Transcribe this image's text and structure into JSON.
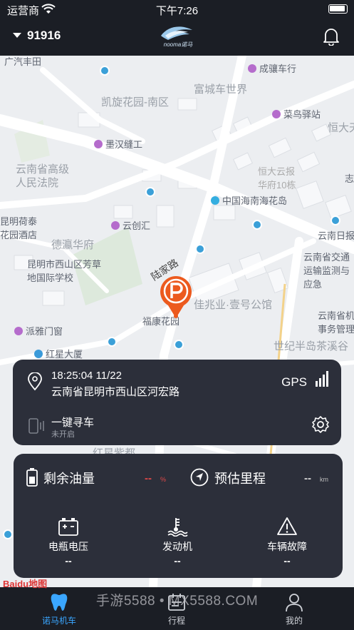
{
  "status_bar": {
    "carrier": "运营商",
    "time": "下午7:26"
  },
  "header": {
    "device_id": "91916",
    "logo_text": "nooma诺马"
  },
  "map": {
    "pois": [
      "广汽丰田",
      "凯旋花园-南区",
      "富城车世界",
      "成骧车行",
      "菜鸟驿站",
      "恒大天",
      "墨汉缝工",
      "云南省高级人民法院",
      "恒大云报华府10栋",
      "中国海南海花岛",
      "昆明荷泰花园酒店",
      "云创汇",
      "德瀛华府",
      "云南日报",
      "云南省交通运输监测与应急",
      "昆明市西山区芳草地国际学校",
      "陆家路",
      "佳兆业·壹号公馆",
      "福康花园",
      "云南省机事务管理",
      "派雅门窗",
      "红星大厦",
      "世纪半岛茶溪谷",
      "红星紫都",
      "志"
    ],
    "attribution": "Baidu地图"
  },
  "location_card": {
    "timestamp": "18:25:04 11/22",
    "address": "云南省昆明市西山区河宏路",
    "gps_label": "GPS",
    "find_car_label": "一键寻车",
    "find_car_status": "未开启"
  },
  "vehicle_card": {
    "fuel_label": "剩余油量",
    "fuel_value": "--",
    "fuel_unit": "%",
    "range_label": "预估里程",
    "range_value": "--",
    "range_unit": "km",
    "stats": [
      {
        "label": "电瓶电压",
        "value": "--"
      },
      {
        "label": "发动机",
        "value": "--"
      },
      {
        "label": "车辆故障",
        "value": "--"
      }
    ]
  },
  "tabbar": {
    "tabs": [
      {
        "label": "诺马机车"
      },
      {
        "label": "行程"
      },
      {
        "label": "我的"
      }
    ],
    "active_color": "#3aa6ff"
  },
  "watermark": "手游5588 • MX5588.COM",
  "colors": {
    "accent": "#3aa6ff",
    "warning": "#e04848",
    "pin": "#ec5a1e",
    "card": "#2c2f3a"
  }
}
